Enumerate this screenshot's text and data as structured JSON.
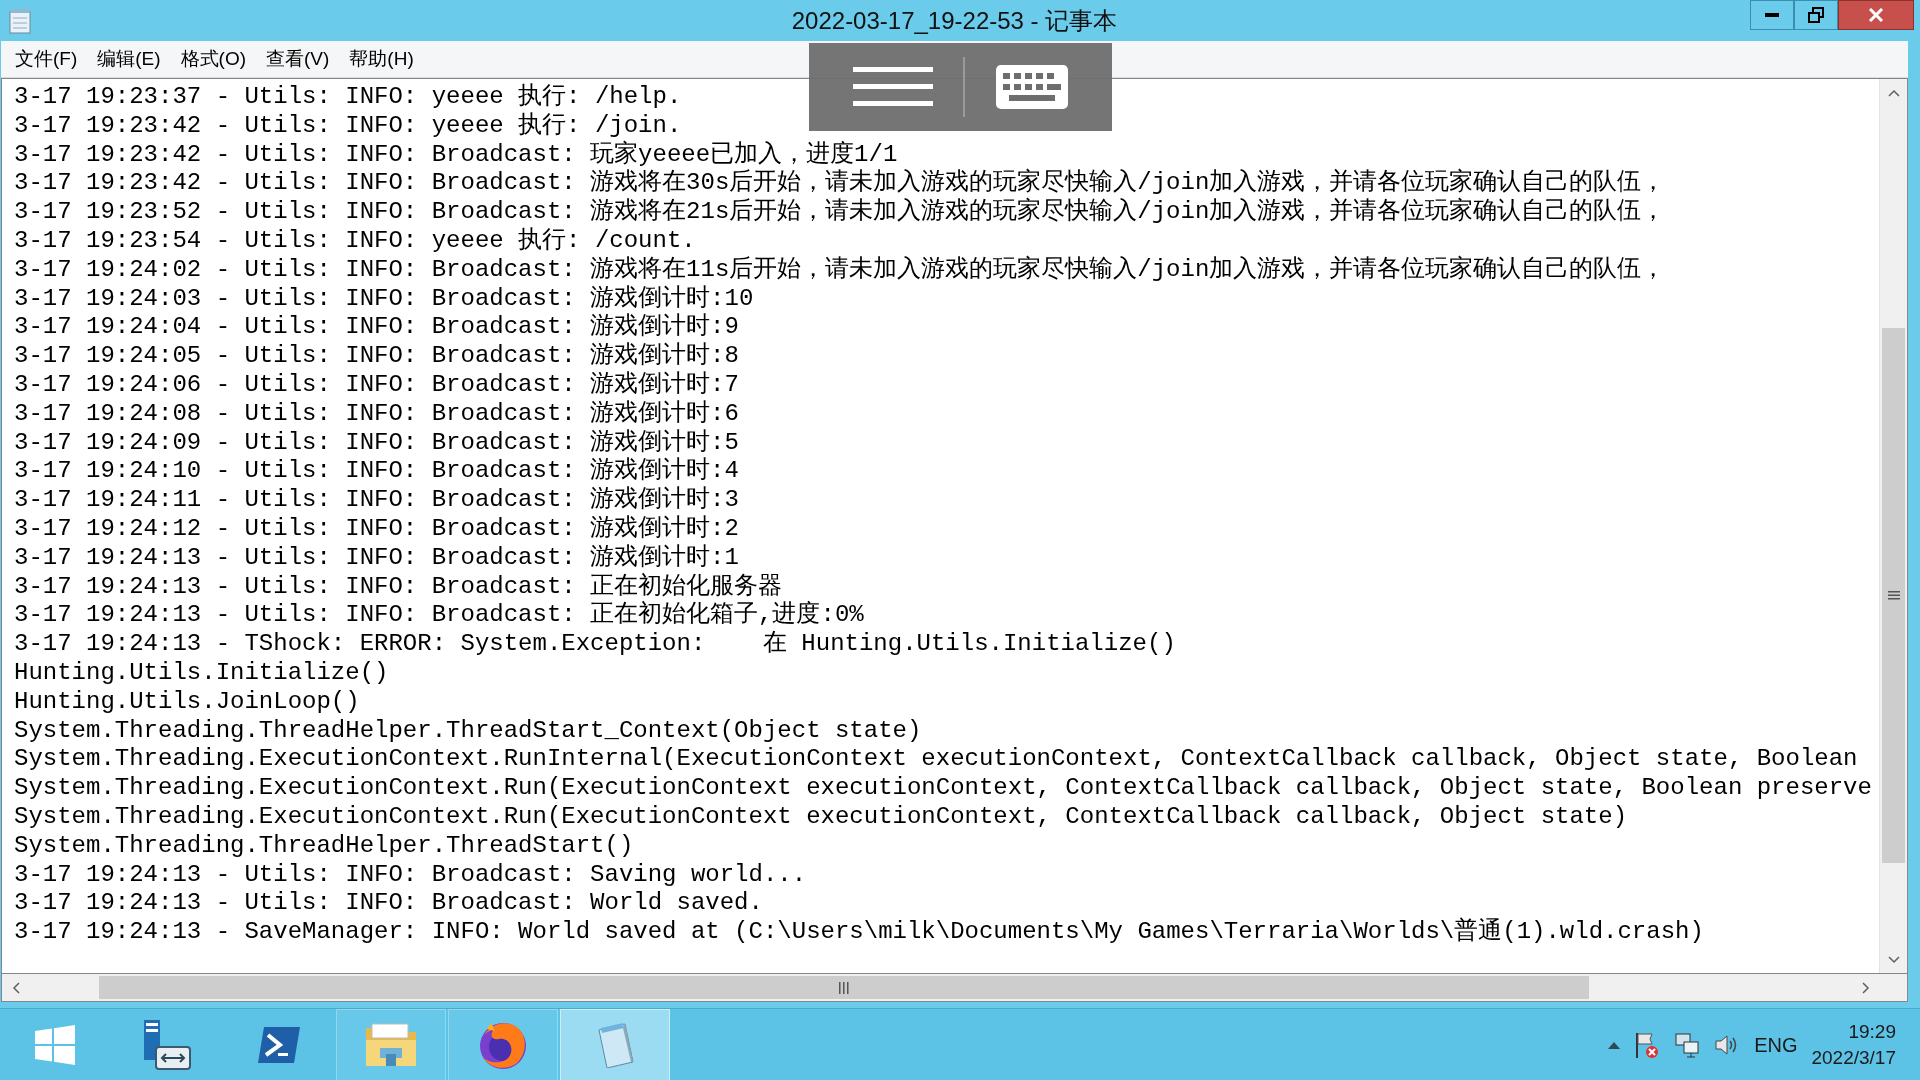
{
  "window": {
    "title": "2022-03-17_19-22-53 - 记事本"
  },
  "menu": [
    {
      "label": "文件(F)"
    },
    {
      "label": "编辑(E)"
    },
    {
      "label": "格式(O)"
    },
    {
      "label": "查看(V)"
    },
    {
      "label": "帮助(H)"
    }
  ],
  "document": {
    "lines": [
      "3-17 19:23:37 - Utils: INFO: yeeee 执行: /help.",
      "3-17 19:23:42 - Utils: INFO: yeeee 执行: /join.",
      "3-17 19:23:42 - Utils: INFO: Broadcast: 玩家yeeee已加入，进度1/1",
      "3-17 19:23:42 - Utils: INFO: Broadcast: 游戏将在30s后开始，请未加入游戏的玩家尽快输入/join加入游戏，并请各位玩家确认自己的队伍，",
      "3-17 19:23:52 - Utils: INFO: Broadcast: 游戏将在21s后开始，请未加入游戏的玩家尽快输入/join加入游戏，并请各位玩家确认自己的队伍，",
      "3-17 19:23:54 - Utils: INFO: yeeee 执行: /count.",
      "3-17 19:24:02 - Utils: INFO: Broadcast: 游戏将在11s后开始，请未加入游戏的玩家尽快输入/join加入游戏，并请各位玩家确认自己的队伍，",
      "3-17 19:24:03 - Utils: INFO: Broadcast: 游戏倒计时:10",
      "3-17 19:24:04 - Utils: INFO: Broadcast: 游戏倒计时:9",
      "3-17 19:24:05 - Utils: INFO: Broadcast: 游戏倒计时:8",
      "3-17 19:24:06 - Utils: INFO: Broadcast: 游戏倒计时:7",
      "3-17 19:24:08 - Utils: INFO: Broadcast: 游戏倒计时:6",
      "3-17 19:24:09 - Utils: INFO: Broadcast: 游戏倒计时:5",
      "3-17 19:24:10 - Utils: INFO: Broadcast: 游戏倒计时:4",
      "3-17 19:24:11 - Utils: INFO: Broadcast: 游戏倒计时:3",
      "3-17 19:24:12 - Utils: INFO: Broadcast: 游戏倒计时:2",
      "3-17 19:24:13 - Utils: INFO: Broadcast: 游戏倒计时:1",
      "3-17 19:24:13 - Utils: INFO: Broadcast: 正在初始化服务器",
      "3-17 19:24:13 - Utils: INFO: Broadcast: 正在初始化箱子,进度:0%",
      "3-17 19:24:13 - TShock: ERROR: System.Exception:    在 Hunting.Utils.Initialize()",
      "Hunting.Utils.Initialize()",
      "Hunting.Utils.JoinLoop()",
      "System.Threading.ThreadHelper.ThreadStart_Context(Object state)",
      "System.Threading.ExecutionContext.RunInternal(ExecutionContext executionContext, ContextCallback callback, Object state, Boolean",
      "System.Threading.ExecutionContext.Run(ExecutionContext executionContext, ContextCallback callback, Object state, Boolean preserve",
      "System.Threading.ExecutionContext.Run(ExecutionContext executionContext, ContextCallback callback, Object state)",
      "System.Threading.ThreadHelper.ThreadStart()",
      "3-17 19:24:13 - Utils: INFO: Broadcast: Saving world...",
      "3-17 19:24:13 - Utils: INFO: Broadcast: World saved.",
      "3-17 19:24:13 - SaveManager: INFO: World saved at (C:\\Users\\milk\\Documents\\My Games\\Terraria\\Worlds\\普通(1).wld.crash)"
    ]
  },
  "taskbar": {
    "apps": [
      {
        "kind": "server-manager",
        "running": false,
        "selected": false
      },
      {
        "kind": "powershell",
        "running": false,
        "selected": false
      },
      {
        "kind": "explorer",
        "running": true,
        "selected": false
      },
      {
        "kind": "firefox",
        "running": true,
        "selected": false
      },
      {
        "kind": "notepad",
        "running": true,
        "selected": true
      }
    ],
    "tray": {
      "language": "ENG",
      "time": "19:29",
      "date": "2022/3/17"
    }
  }
}
